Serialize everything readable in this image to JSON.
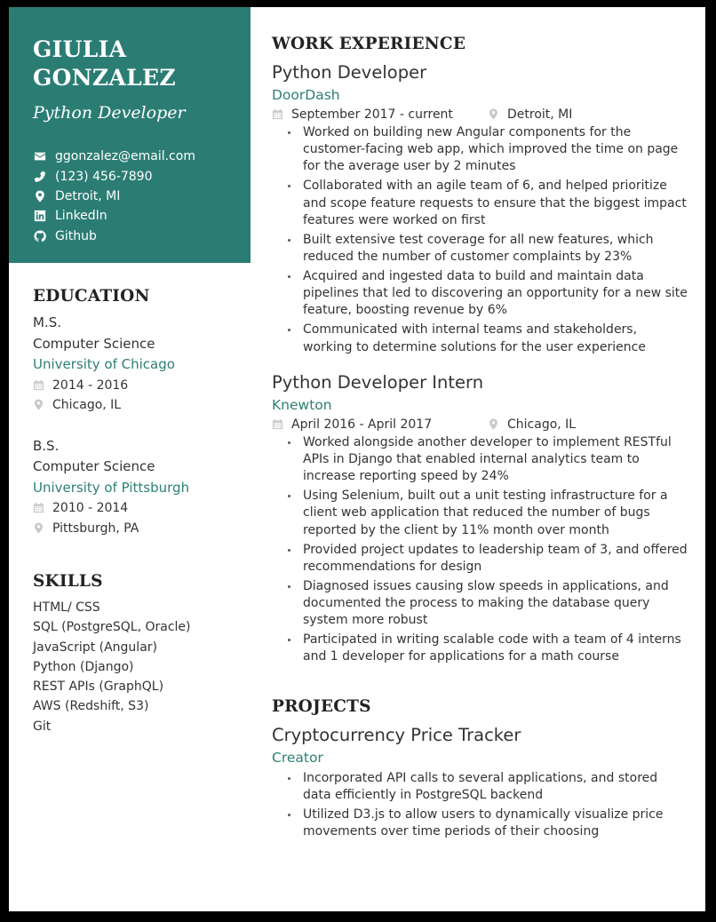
{
  "header": {
    "name_first": "GIULIA",
    "name_last": "GONZALEZ",
    "role": "Python Developer",
    "contacts": [
      {
        "icon": "envelope-icon",
        "text": "ggonzalez@email.com"
      },
      {
        "icon": "phone-icon",
        "text": "(123) 456-7890"
      },
      {
        "icon": "map-pin-icon",
        "text": "Detroit, MI"
      },
      {
        "icon": "linkedin-icon",
        "text": "LinkedIn"
      },
      {
        "icon": "github-icon",
        "text": "Github"
      }
    ]
  },
  "colors": {
    "accent": "#2b7d74",
    "accent_text": "#2e8074",
    "body_text": "#333333",
    "meta_icon": "#c9c9c9",
    "frame": "#000000"
  },
  "education": {
    "heading": "EDUCATION",
    "entries": [
      {
        "degree": "M.S.",
        "field": "Computer Science",
        "school": "University of Chicago",
        "dates": "2014 - 2016",
        "location": "Chicago, IL"
      },
      {
        "degree": "B.S.",
        "field": "Computer Science",
        "school": "University of Pittsburgh",
        "dates": "2010 - 2014",
        "location": "Pittsburgh, PA"
      }
    ]
  },
  "skills": {
    "heading": "SKILLS",
    "items": [
      "HTML/ CSS",
      "SQL (PostgreSQL, Oracle)",
      "JavaScript (Angular)",
      "Python (Django)",
      "REST APIs (GraphQL)",
      "AWS (Redshift, S3)",
      "Git"
    ]
  },
  "work": {
    "heading": "WORK EXPERIENCE",
    "jobs": [
      {
        "title": "Python Developer",
        "company": "DoorDash",
        "dates": "September 2017 - current",
        "location": "Detroit, MI",
        "bullets": [
          "Worked on building new Angular components for the customer-facing web app, which improved the time on page for the average user by 2 minutes",
          "Collaborated with an agile team of 6, and helped prioritize and scope feature requests to ensure that the biggest impact features were worked on first",
          "Built extensive test coverage for all new features, which reduced the number of customer complaints by 23%",
          "Acquired and ingested data to build and maintain data pipelines that led to discovering an opportunity for a new site feature, boosting revenue by 6%",
          "Communicated with internal teams and stakeholders, working to determine solutions for the user experience"
        ]
      },
      {
        "title": "Python Developer Intern",
        "company": "Knewton",
        "dates": "April 2016 - April 2017",
        "location": "Chicago, IL",
        "bullets": [
          "Worked alongside another developer to implement RESTful APIs in Django that enabled internal analytics team to increase reporting speed by 24%",
          "Using Selenium, built out a unit testing infrastructure for a client web application that reduced the number of bugs reported by the client by 11% month over month",
          "Provided project updates to leadership team of 3, and offered recommendations for design",
          "Diagnosed issues causing slow speeds in applications, and documented the process to making the database query system more robust",
          "Participated in writing scalable code with a team of 4 interns and 1 developer for applications for a math course"
        ]
      }
    ]
  },
  "projects": {
    "heading": "PROJECTS",
    "items": [
      {
        "title": "Cryptocurrency Price Tracker",
        "role": "Creator",
        "bullets": [
          "Incorporated API calls to several applications, and stored data efficiently in PostgreSQL backend",
          "Utilized D3.js to allow users to dynamically visualize price movements over time periods of their choosing"
        ]
      }
    ]
  }
}
